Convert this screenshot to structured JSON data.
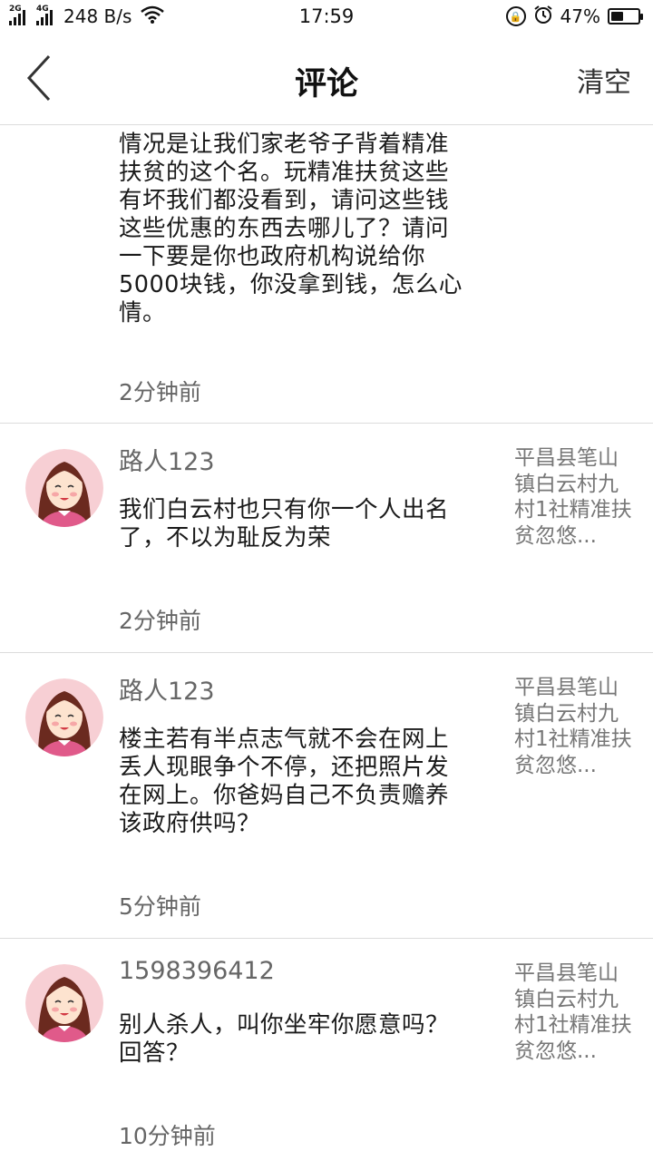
{
  "status_bar": {
    "network_1": "2G",
    "network_2": "4G",
    "speed": "248 B/s",
    "time": "17:59",
    "battery": "47%",
    "battery_level": 0.47
  },
  "header": {
    "title": "评论",
    "clear_label": "清空"
  },
  "comments": [
    {
      "author": "",
      "text": "情况是让我们家老爷子背着精准扶贫的这个名。玩精准扶贫这些有坏我们都没看到，请问这些钱这些优惠的东西去哪儿了？请问一下要是你也政府机构说给你5000块钱，你没拿到钱，怎么心情。",
      "time": "2分钟前",
      "post_title": ""
    },
    {
      "author": "路人123",
      "text": "我们白云村也只有你一个人出名了，不以为耻反为荣",
      "time": "2分钟前",
      "post_title": "平昌县笔山镇白云村九村1社精准扶贫忽悠..."
    },
    {
      "author": "路人123",
      "text": "楼主若有半点志气就不会在网上丢人现眼争个不停，还把照片发在网上。你爸妈自己不负责赡养该政府供吗？",
      "time": "5分钟前",
      "post_title": "平昌县笔山镇白云村九村1社精准扶贫忽悠..."
    },
    {
      "author": "1598396412",
      "text": "别人杀人，叫你坐牢你愿意吗？回答？",
      "time": "10分钟前",
      "post_title": "平昌县笔山镇白云村九村1社精准扶贫忽悠..."
    }
  ]
}
